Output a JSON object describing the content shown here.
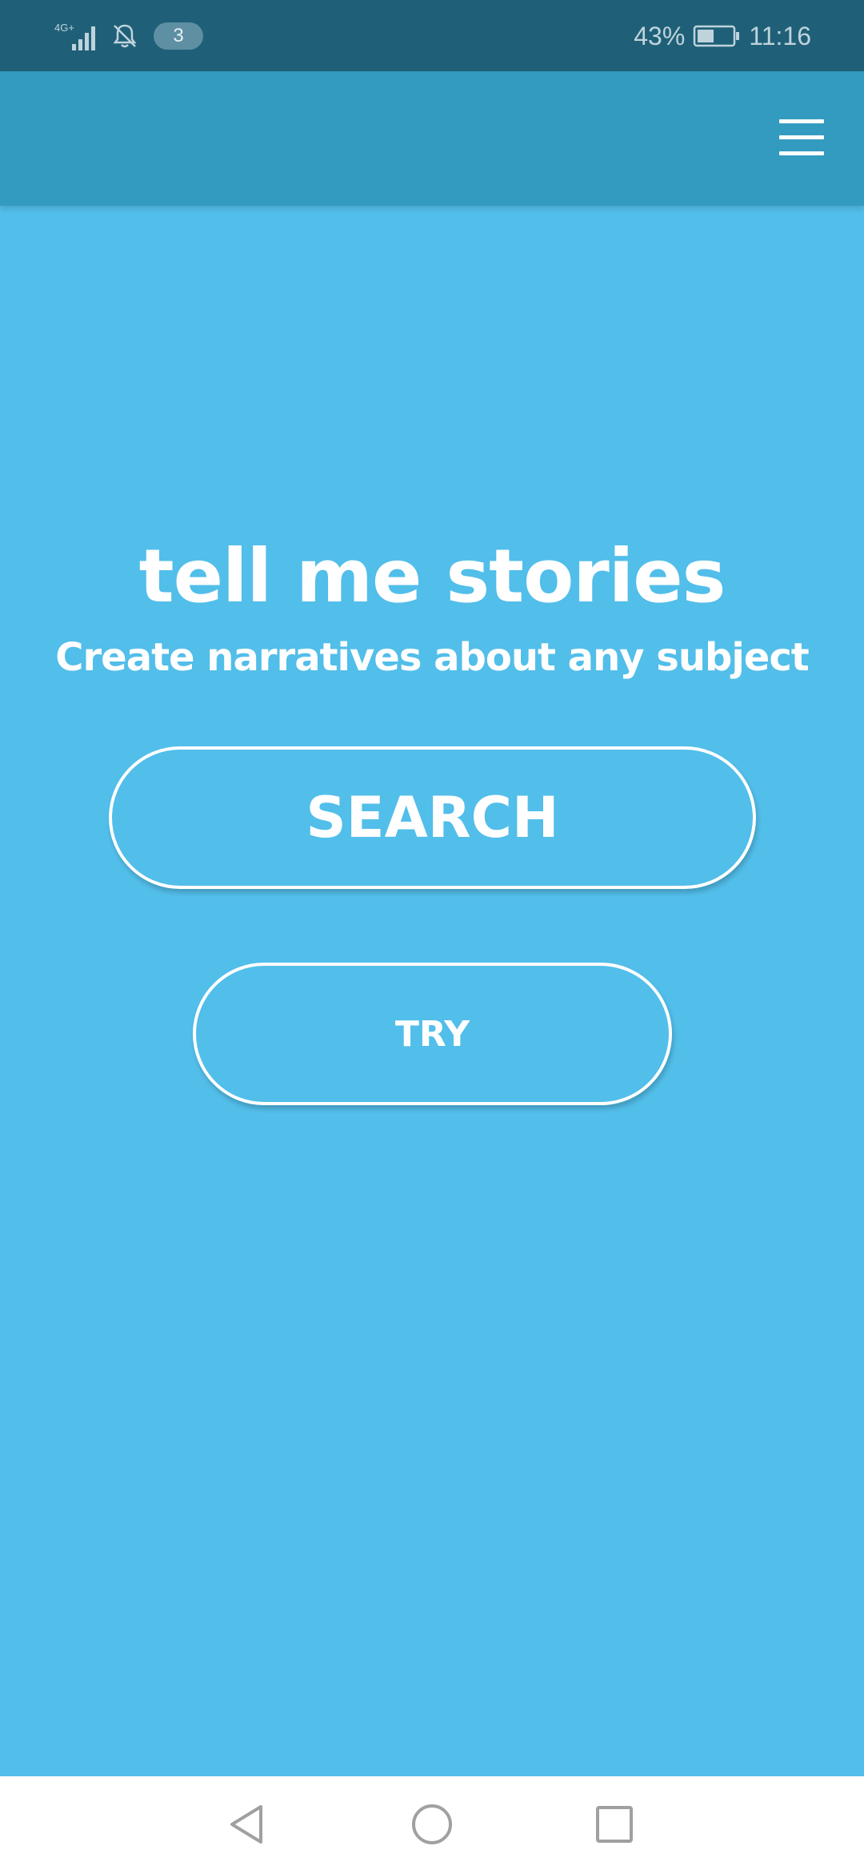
{
  "status_bar": {
    "network": "4G+",
    "notification_count": "3",
    "battery": "43%",
    "time": "11:16"
  },
  "app_bar": {
    "menu_icon": "hamburger-menu-icon"
  },
  "main": {
    "title": "tell me stories",
    "subtitle": "Create narratives about any subject",
    "search_label": "SEARCH",
    "try_label": "TRY"
  },
  "nav_bar": {
    "back_icon": "back-triangle-icon",
    "home_icon": "home-circle-icon",
    "recent_icon": "recent-apps-square-icon"
  },
  "colors": {
    "status_bar": "#1F6078",
    "app_bar": "#339BC0",
    "background": "#52BEEA",
    "text": "#FFFFFF",
    "nav_bar": "#FFFFFF"
  }
}
